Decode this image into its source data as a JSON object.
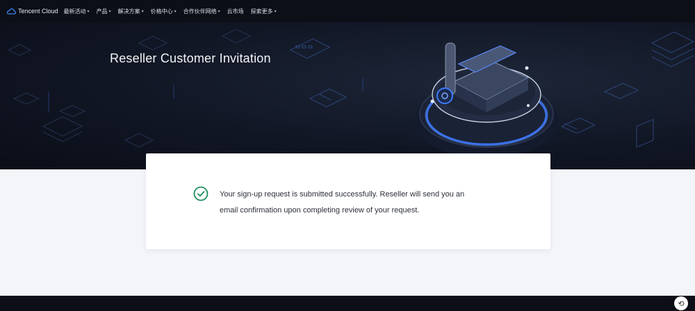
{
  "nav": {
    "logo_text": "Tencent Cloud",
    "items": [
      {
        "label": "最新活动"
      },
      {
        "label": "产品"
      },
      {
        "label": "解决方案"
      },
      {
        "label": "价格中心"
      },
      {
        "label": "合作伙伴网络"
      },
      {
        "label": "云市场"
      },
      {
        "label": "探索更多"
      }
    ]
  },
  "hero": {
    "title": "Reseller Customer Invitation"
  },
  "result": {
    "status": "success",
    "message_line1": "Your sign-up request is submitted successfully. Reseller will send you an",
    "message_line2": "email confirmation upon completing review of your request."
  },
  "floating_button": {
    "label": "⟲"
  },
  "colors": {
    "nav_bg": "#0c0f17",
    "hero_bg": "#111624",
    "page_bg": "#f4f5f9",
    "success": "#1e8f5a",
    "accent_blue": "#2f6bff"
  }
}
